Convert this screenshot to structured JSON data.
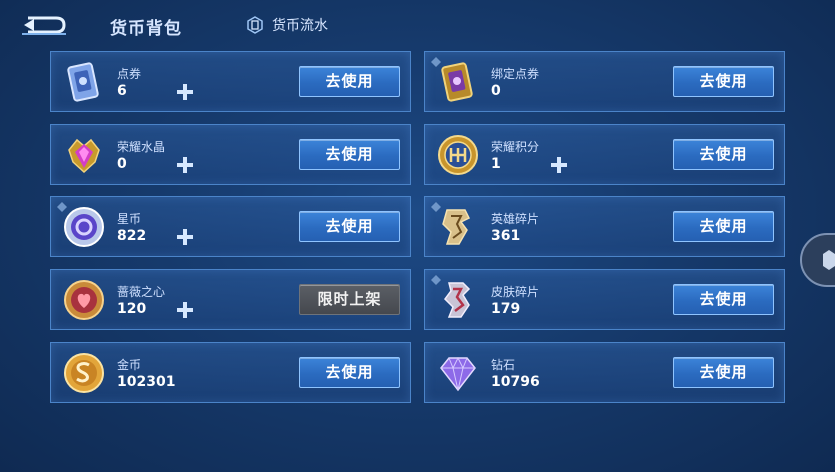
{
  "header": {
    "title": "货币背包",
    "flow_label": "货币流水"
  },
  "currencies": [
    {
      "name": "点券",
      "amount": "6",
      "action": "去使用",
      "icon": "voucher-card-icon"
    },
    {
      "name": "绑定点券",
      "amount": "0",
      "action": "去使用",
      "icon": "bound-voucher-card-icon"
    },
    {
      "name": "荣耀水晶",
      "amount": "0",
      "action": "去使用",
      "icon": "honor-crystal-icon"
    },
    {
      "name": "荣耀积分",
      "amount": "1",
      "action": "去使用",
      "icon": "honor-points-icon"
    },
    {
      "name": "星币",
      "amount": "822",
      "action": "去使用",
      "icon": "star-coin-icon"
    },
    {
      "name": "英雄碎片",
      "amount": "361",
      "action": "去使用",
      "icon": "hero-fragment-icon"
    },
    {
      "name": "蔷薇之心",
      "amount": "120",
      "action": "限时上架",
      "icon": "rose-heart-icon"
    },
    {
      "name": "皮肤碎片",
      "amount": "179",
      "action": "去使用",
      "icon": "skin-fragment-icon"
    },
    {
      "name": "金币",
      "amount": "102301",
      "action": "去使用",
      "icon": "gold-coin-icon"
    },
    {
      "name": "钻石",
      "amount": "10796",
      "action": "去使用",
      "icon": "diamond-icon"
    }
  ],
  "colors": {
    "background": "#163a6c",
    "card_border": "#4b84c9",
    "button": "#2f72c8",
    "limited_button": "#4e5258"
  }
}
